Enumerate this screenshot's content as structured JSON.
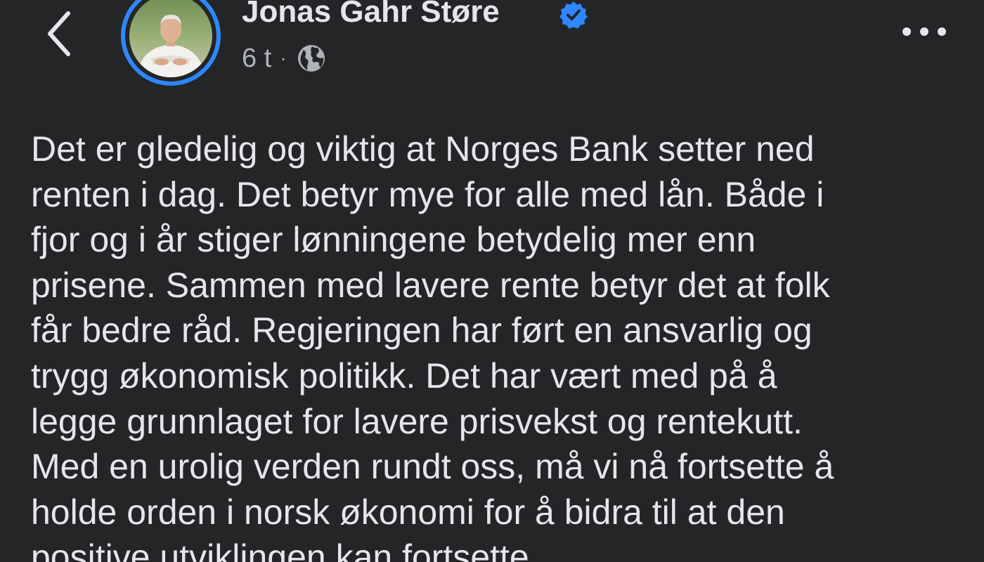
{
  "header": {
    "back_icon": "chevron-left-icon",
    "author_name": "Jonas Gahr Støre",
    "verified_icon": "verified-badge-icon",
    "timestamp": "6 t",
    "separator": "·",
    "audience_icon": "globe-icon",
    "more_icon": "more-horizontal-icon"
  },
  "post": {
    "body": "Det er gledelig og viktig at Norges Bank setter ned\nrenten i dag. Det betyr mye for alle med lån. Både i\nfjor og i år stiger lønningene betydelig mer enn\nprisene. Sammen med lavere rente betyr det at folk\nfår bedre råd. Regjeringen har ført en ansvarlig og\ntrygg økonomisk politikk. Det har vært med på å\nlegge grunnlaget for lavere prisvekst og rentekutt.\nMed en urolig verden rundt oss, må vi nå fortsette å\nholde orden i norsk økonomi for å bidra til at den\npositive utviklingen kan fortsette."
  },
  "colors": {
    "background": "#242526",
    "primary_text": "#E4E6EB",
    "secondary_text": "#B0B3B8",
    "accent": "#2D88FF"
  }
}
